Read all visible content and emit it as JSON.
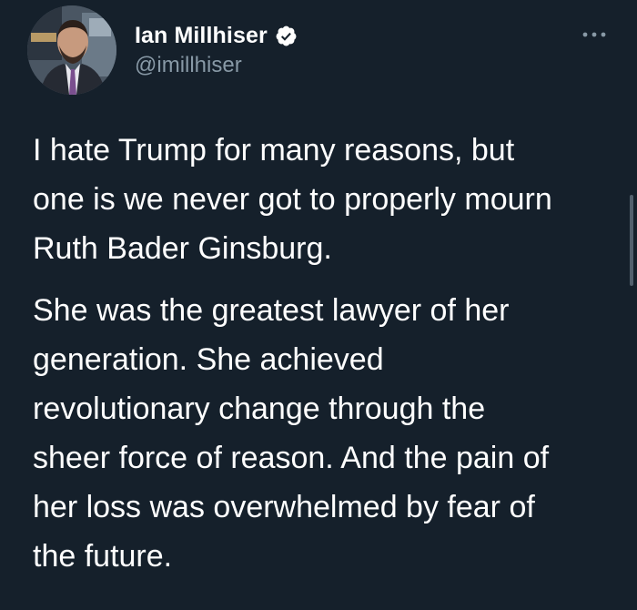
{
  "author": {
    "display_name": "Ian Millhiser",
    "handle": "@imillhiser",
    "verified": true,
    "avatar_icon": "profile-photo"
  },
  "menu": {
    "icon": "more-horizontal-icon"
  },
  "tweet": {
    "paragraphs": [
      {
        "lines": [
          "I hate Trump for many reasons, but",
          "one is we never got to properly mourn",
          "Ruth Bader Ginsburg."
        ]
      },
      {
        "lines": [
          "She was the greatest lawyer of her",
          "generation. She achieved",
          "revolutionary change through the",
          "sheer force of reason. And the pain of",
          "her loss was overwhelmed by fear of",
          "the future."
        ]
      }
    ]
  },
  "colors": {
    "background": "#15202b",
    "text": "#ffffff",
    "secondary_text": "#8899a6",
    "verified_badge": "#ffffff"
  }
}
